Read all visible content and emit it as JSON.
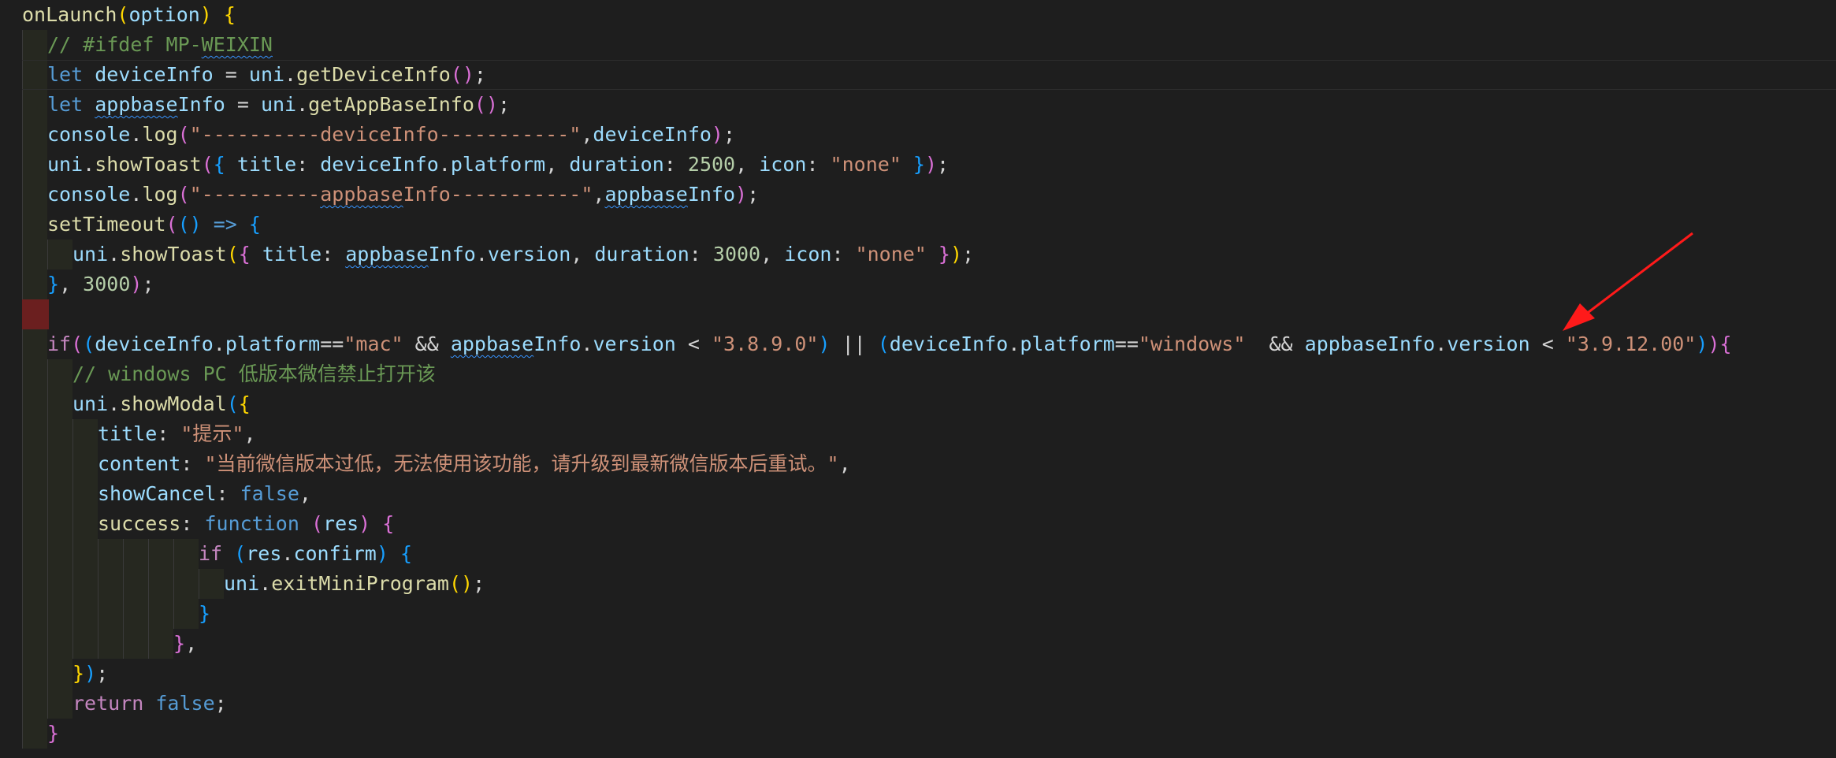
{
  "editor": {
    "theme": {
      "background": "#1e1e1e",
      "keyword": "#569cd6",
      "string": "#ce9178",
      "comment": "#6a9955",
      "function": "#dcdcaa",
      "variable": "#9cdcfe",
      "number": "#b5cea8",
      "arrow_color": "#ff1a1a"
    },
    "lines": [
      {
        "indent": 0,
        "tokens": [
          [
            "fn",
            "onLaunch"
          ],
          [
            "br1",
            "("
          ],
          [
            "var",
            "option"
          ],
          [
            "br1",
            ")"
          ],
          [
            "op",
            " "
          ],
          [
            "br1",
            "{"
          ]
        ]
      },
      {
        "indent": 1,
        "tokens": [
          [
            "com",
            "// #ifdef MP-"
          ],
          [
            "com-sq",
            "WEIXIN"
          ]
        ]
      },
      {
        "indent": 1,
        "current": true,
        "tokens": [
          [
            "kw",
            "let"
          ],
          [
            "op",
            " "
          ],
          [
            "var",
            "deviceInfo"
          ],
          [
            "op",
            " = "
          ],
          [
            "var",
            "uni"
          ],
          [
            "op",
            "."
          ],
          [
            "fn",
            "getDeviceInfo"
          ],
          [
            "br2",
            "()"
          ],
          [
            "op",
            ";"
          ]
        ]
      },
      {
        "indent": 1,
        "tokens": [
          [
            "kw",
            "let"
          ],
          [
            "op",
            " "
          ],
          [
            "var-sq",
            "appbase"
          ],
          [
            "var",
            "Info"
          ],
          [
            "op",
            " = "
          ],
          [
            "var",
            "uni"
          ],
          [
            "op",
            "."
          ],
          [
            "fn",
            "getAppBaseInfo"
          ],
          [
            "br2",
            "()"
          ],
          [
            "op",
            ";"
          ]
        ]
      },
      {
        "indent": 1,
        "tokens": [
          [
            "var",
            "console"
          ],
          [
            "op",
            "."
          ],
          [
            "fn",
            "log"
          ],
          [
            "br2",
            "("
          ],
          [
            "str",
            "\"----------deviceInfo-----------\""
          ],
          [
            "op",
            ","
          ],
          [
            "var",
            "deviceInfo"
          ],
          [
            "br2",
            ")"
          ],
          [
            "op",
            ";"
          ]
        ]
      },
      {
        "indent": 1,
        "tokens": [
          [
            "var",
            "uni"
          ],
          [
            "op",
            "."
          ],
          [
            "fn",
            "showToast"
          ],
          [
            "br2",
            "("
          ],
          [
            "br3",
            "{"
          ],
          [
            "op",
            " "
          ],
          [
            "var",
            "title"
          ],
          [
            "op",
            ": "
          ],
          [
            "var",
            "deviceInfo"
          ],
          [
            "op",
            "."
          ],
          [
            "var",
            "platform"
          ],
          [
            "op",
            ", "
          ],
          [
            "var",
            "duration"
          ],
          [
            "op",
            ": "
          ],
          [
            "num",
            "2500"
          ],
          [
            "op",
            ", "
          ],
          [
            "var",
            "icon"
          ],
          [
            "op",
            ": "
          ],
          [
            "str",
            "\"none\""
          ],
          [
            "op",
            " "
          ],
          [
            "br3",
            "}"
          ],
          [
            "br2",
            ")"
          ],
          [
            "op",
            ";"
          ]
        ]
      },
      {
        "indent": 1,
        "tokens": [
          [
            "var",
            "console"
          ],
          [
            "op",
            "."
          ],
          [
            "fn",
            "log"
          ],
          [
            "br2",
            "("
          ],
          [
            "str",
            "\"----------"
          ],
          [
            "str-sq",
            "appbase"
          ],
          [
            "str",
            "Info-----------\""
          ],
          [
            "op",
            ","
          ],
          [
            "var-sq",
            "appbase"
          ],
          [
            "var",
            "Info"
          ],
          [
            "br2",
            ")"
          ],
          [
            "op",
            ";"
          ]
        ]
      },
      {
        "indent": 1,
        "tokens": [
          [
            "fn",
            "setTimeout"
          ],
          [
            "br2",
            "("
          ],
          [
            "br3",
            "()"
          ],
          [
            "op",
            " "
          ],
          [
            "kw",
            "=>"
          ],
          [
            "op",
            " "
          ],
          [
            "br3",
            "{"
          ]
        ]
      },
      {
        "indent": 2,
        "tokens": [
          [
            "var",
            "uni"
          ],
          [
            "op",
            "."
          ],
          [
            "fn",
            "showToast"
          ],
          [
            "br1",
            "("
          ],
          [
            "br2",
            "{"
          ],
          [
            "op",
            " "
          ],
          [
            "var",
            "title"
          ],
          [
            "op",
            ": "
          ],
          [
            "var-sq",
            "appbase"
          ],
          [
            "var",
            "Info"
          ],
          [
            "op",
            "."
          ],
          [
            "var",
            "version"
          ],
          [
            "op",
            ", "
          ],
          [
            "var",
            "duration"
          ],
          [
            "op",
            ": "
          ],
          [
            "num",
            "3000"
          ],
          [
            "op",
            ", "
          ],
          [
            "var",
            "icon"
          ],
          [
            "op",
            ": "
          ],
          [
            "str",
            "\"none\""
          ],
          [
            "op",
            " "
          ],
          [
            "br2",
            "}"
          ],
          [
            "br1",
            ")"
          ],
          [
            "op",
            ";"
          ]
        ]
      },
      {
        "indent": 1,
        "tokens": [
          [
            "br3",
            "}"
          ],
          [
            "op",
            ", "
          ],
          [
            "num",
            "3000"
          ],
          [
            "br2",
            ")"
          ],
          [
            "op",
            ";"
          ]
        ]
      },
      {
        "indent": 0,
        "breakpoint": true,
        "tokens": []
      },
      {
        "indent": 1,
        "tokens": [
          [
            "ctl",
            "if"
          ],
          [
            "br2",
            "("
          ],
          [
            "br3",
            "("
          ],
          [
            "var",
            "deviceInfo"
          ],
          [
            "op",
            "."
          ],
          [
            "var",
            "platform"
          ],
          [
            "op",
            "=="
          ],
          [
            "str",
            "\"mac\""
          ],
          [
            "op",
            " && "
          ],
          [
            "var-sq",
            "appbase"
          ],
          [
            "var",
            "Info"
          ],
          [
            "op",
            "."
          ],
          [
            "var",
            "version"
          ],
          [
            "op",
            " < "
          ],
          [
            "str",
            "\"3.8.9.0\""
          ],
          [
            "br3",
            ")"
          ],
          [
            "op",
            " || "
          ],
          [
            "br3",
            "("
          ],
          [
            "var",
            "deviceInfo"
          ],
          [
            "op",
            "."
          ],
          [
            "var",
            "platform"
          ],
          [
            "op",
            "=="
          ],
          [
            "str",
            "\"windows\""
          ],
          [
            "op",
            "  && "
          ],
          [
            "var",
            "appbaseInfo"
          ],
          [
            "op",
            "."
          ],
          [
            "var",
            "version"
          ],
          [
            "op",
            " < "
          ],
          [
            "str",
            "\"3.9.12.00\""
          ],
          [
            "br3",
            ")"
          ],
          [
            "br2",
            ")"
          ],
          [
            "br2",
            "{"
          ]
        ]
      },
      {
        "indent": 2,
        "tokens": [
          [
            "com",
            "// windows PC 低版本微信禁止打开该"
          ]
        ]
      },
      {
        "indent": 2,
        "tokens": [
          [
            "var",
            "uni"
          ],
          [
            "op",
            "."
          ],
          [
            "fn",
            "showModal"
          ],
          [
            "br3",
            "("
          ],
          [
            "br1",
            "{"
          ]
        ]
      },
      {
        "indent": 3,
        "tokens": [
          [
            "var",
            "title"
          ],
          [
            "op",
            ": "
          ],
          [
            "str",
            "\"提示\""
          ],
          [
            "op",
            ","
          ]
        ]
      },
      {
        "indent": 3,
        "tokens": [
          [
            "var",
            "content"
          ],
          [
            "op",
            ": "
          ],
          [
            "str",
            "\"当前微信版本过低，无法使用该功能，请升级到最新微信版本后重试。\""
          ],
          [
            "op",
            ","
          ]
        ]
      },
      {
        "indent": 3,
        "tokens": [
          [
            "var",
            "showCancel"
          ],
          [
            "op",
            ": "
          ],
          [
            "kw",
            "false"
          ],
          [
            "op",
            ","
          ]
        ]
      },
      {
        "indent": 3,
        "tokens": [
          [
            "fn",
            "success"
          ],
          [
            "op",
            ": "
          ],
          [
            "kw",
            "function"
          ],
          [
            "op",
            " "
          ],
          [
            "br2",
            "("
          ],
          [
            "var",
            "res"
          ],
          [
            "br2",
            ")"
          ],
          [
            "op",
            " "
          ],
          [
            "br2",
            "{"
          ]
        ]
      },
      {
        "indent": 7,
        "tokens": [
          [
            "ctl",
            "if"
          ],
          [
            "op",
            " "
          ],
          [
            "br3",
            "("
          ],
          [
            "var",
            "res"
          ],
          [
            "op",
            "."
          ],
          [
            "var",
            "confirm"
          ],
          [
            "br3",
            ")"
          ],
          [
            "op",
            " "
          ],
          [
            "br3",
            "{"
          ]
        ]
      },
      {
        "indent": 8,
        "tokens": [
          [
            "var",
            "uni"
          ],
          [
            "op",
            "."
          ],
          [
            "fn",
            "exitMiniProgram"
          ],
          [
            "br1",
            "()"
          ],
          [
            "op",
            ";"
          ]
        ]
      },
      {
        "indent": 7,
        "tokens": [
          [
            "br3",
            "}"
          ]
        ]
      },
      {
        "indent": 6,
        "tokens": [
          [
            "br2",
            "}"
          ],
          [
            "op",
            ","
          ]
        ]
      },
      {
        "indent": 2,
        "tokens": [
          [
            "br1",
            "}"
          ],
          [
            "br3",
            ")"
          ],
          [
            "op",
            ";"
          ]
        ]
      },
      {
        "indent": 2,
        "tokens": [
          [
            "ctl",
            "return"
          ],
          [
            "op",
            " "
          ],
          [
            "kw",
            "false"
          ],
          [
            "op",
            ";"
          ]
        ]
      },
      {
        "indent": 1,
        "tokens": [
          [
            "br2",
            "}"
          ]
        ]
      }
    ]
  }
}
